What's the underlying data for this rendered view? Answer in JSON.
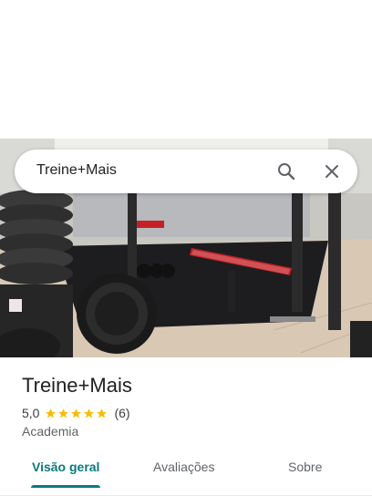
{
  "search": {
    "query": "Treine+Mais",
    "search_icon": "search-icon",
    "close_icon": "close-icon"
  },
  "photo": {
    "description_icon": "gym-photo"
  },
  "place": {
    "title": "Treine+Mais",
    "rating": "5,0",
    "stars": 5,
    "reviews": "(6)",
    "category": "Academia"
  },
  "tabs": [
    {
      "label": "Visão geral",
      "active": true
    },
    {
      "label": "Avaliações",
      "active": false
    },
    {
      "label": "Sobre",
      "active": false
    }
  ],
  "colors": {
    "accent": "#0a7a7c",
    "star": "#fbbc04"
  }
}
